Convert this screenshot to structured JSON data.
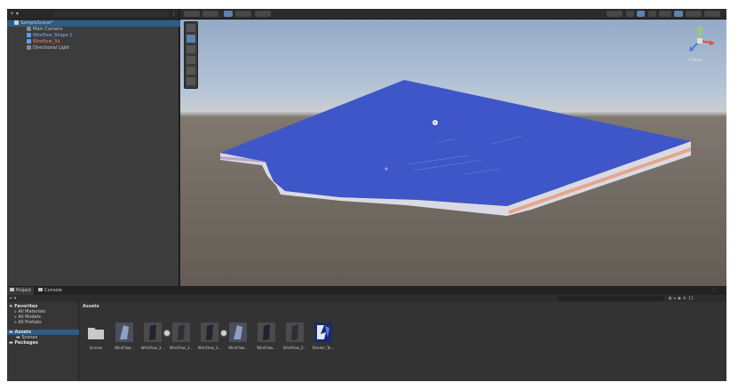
{
  "hierarchy": {
    "toolbar": {
      "add": "+ ▾"
    },
    "items": [
      {
        "label": "SampleScene*"
      },
      {
        "label": "Main Camera"
      },
      {
        "label": "Wireflow_Shape 1"
      },
      {
        "label": "Wireflow_3d"
      },
      {
        "label": "Directional Light"
      }
    ]
  },
  "scene": {
    "persp": "< Persp"
  },
  "bottom": {
    "tabs": [
      {
        "label": "Project"
      },
      {
        "label": "Console"
      }
    ],
    "add": "+ ▾",
    "tree": {
      "favorites": "Favorites",
      "fav_items": [
        "All Materials",
        "All Models",
        "All Prefabs"
      ],
      "assets": "Assets",
      "asset_items": [
        "Scenes"
      ],
      "packages": "Packages"
    },
    "breadcrumb": "Assets",
    "assets": [
      {
        "label": "Scenes"
      },
      {
        "label": "WireFlow..."
      },
      {
        "label": "WireFlow_3..."
      },
      {
        "label": "WireFlow_3..."
      },
      {
        "label": "WireFlow_3..."
      },
      {
        "label": "WireFlow..."
      },
      {
        "label": "WireFlow..."
      },
      {
        "label": "WireFlow_3..."
      },
      {
        "label": "Render_Te..."
      }
    ],
    "count": "11"
  },
  "colors": {
    "terrain_top": "#3f56c8",
    "terrain_side": "#d9dae3",
    "accent_selected": "#2c5d87"
  }
}
